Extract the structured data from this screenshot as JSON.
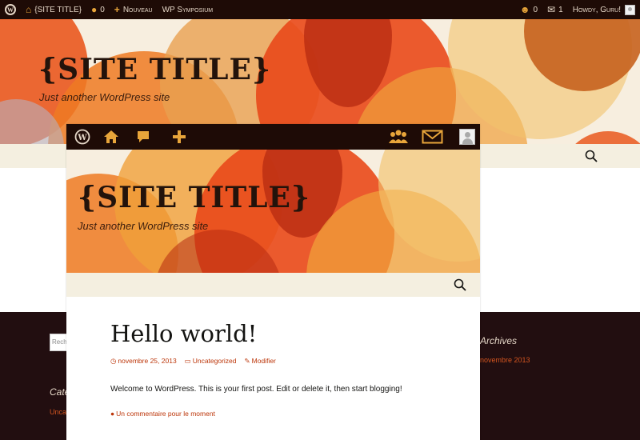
{
  "admin_bar": {
    "site_name": "{SITE TITLE}",
    "comments_count": "0",
    "new_label": "Nouveau",
    "plugin_label": "WP Symposium",
    "friends_count": "0",
    "mail_count": "1",
    "greeting": "Howdy, Guru!"
  },
  "background_page": {
    "site_title": "{SITE TITLE}",
    "tagline": "Just another WordPress site",
    "search_partial": "Rech",
    "widgets": {
      "categories_partial": "Cate",
      "categories_link_partial": "Unca",
      "archives_title": "Archives",
      "archives_link": "novembre 2013"
    }
  },
  "foreground_page": {
    "site_title": "{SITE TITLE}",
    "tagline": "Just another WordPress site",
    "post": {
      "title": "Hello world!",
      "date": "novembre 25, 2013",
      "category": "Uncategorized",
      "edit_label": "Modifier",
      "body": "Welcome to WordPress. This is your first post. Edit or delete it, then start blogging!",
      "comments_link": "Un commentaire pour le moment"
    }
  },
  "colors": {
    "admin_bar": "#1e0b06",
    "accent_orange": "#e8a53a",
    "link_red": "#bc360a",
    "footer_bg": "#220e10",
    "header_bg": "#f7eedf"
  }
}
